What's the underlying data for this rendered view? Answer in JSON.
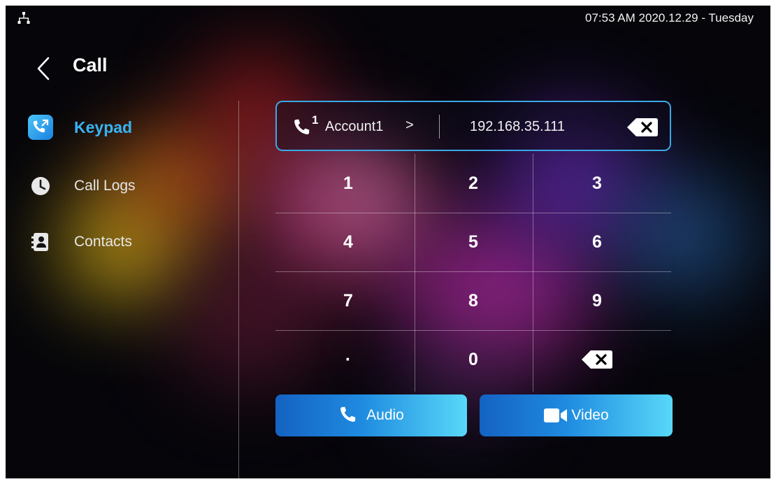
{
  "status_bar": {
    "datetime": "07:53 AM  2020.12.29 - Tuesday",
    "network_icon": "network-icon"
  },
  "header": {
    "back_icon": "chevron-left-icon",
    "title": "Call"
  },
  "sidebar": {
    "items": [
      {
        "label": "Keypad",
        "icon": "phone-outgoing-icon",
        "active": true
      },
      {
        "label": "Call Logs",
        "icon": "clock-icon",
        "active": false
      },
      {
        "label": "Contacts",
        "icon": "contact-book-icon",
        "active": false
      }
    ]
  },
  "dial_bar": {
    "account_line": "1",
    "account_label": "Account1",
    "chevron": ">",
    "number": "192.168.35.111"
  },
  "keypad": {
    "keys": [
      "1",
      "2",
      "3",
      "4",
      "5",
      "6",
      "7",
      "8",
      "9",
      "·",
      "0"
    ]
  },
  "actions": {
    "audio_label": "Audio",
    "video_label": "Video"
  },
  "colors": {
    "accent": "#38b3f5",
    "button_gradient_start": "#1462c2",
    "button_gradient_end": "#58d8f8"
  }
}
